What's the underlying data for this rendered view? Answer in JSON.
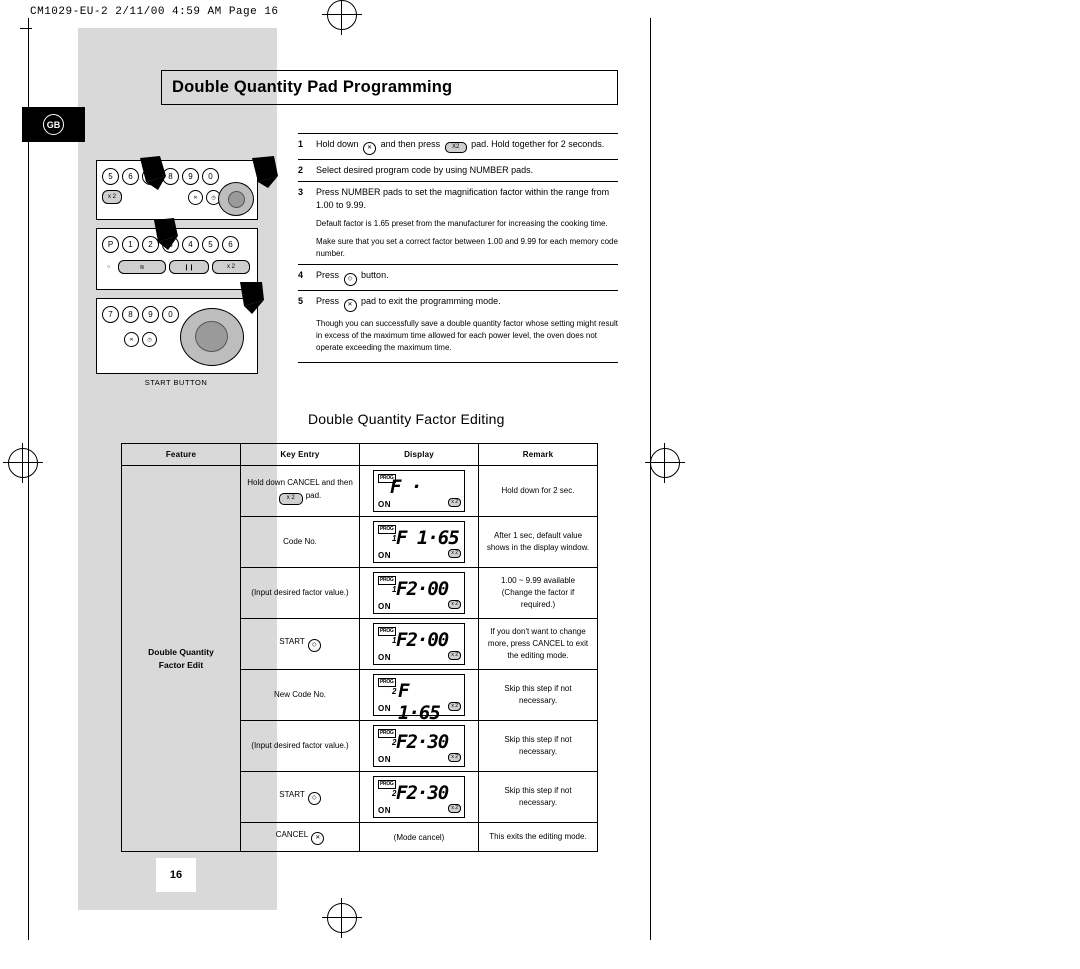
{
  "print_header": "CM1029-EU-2  2/11/00 4:59 AM  Page 16",
  "region_badge": "GB",
  "title": "Double Quantity Pad Programming",
  "steps": [
    {
      "num": "1",
      "text_parts": [
        "Hold down",
        "KEY1",
        "and then press",
        "X2",
        "pad. Hold together for 2 seconds."
      ]
    },
    {
      "num": "2",
      "text": "Select desired program code by using NUMBER pads."
    },
    {
      "num": "3",
      "text": "Press NUMBER pads to set the magnification factor within the range from 1.00 to 9.99.",
      "sub": [
        "Default factor is 1.65 preset from the manufacturer for increasing the cooking time.",
        "Make sure that you set a correct factor between 1.00 and 9.99 for each memory code number."
      ]
    },
    {
      "num": "4",
      "text_parts": [
        "Press",
        "KEY2",
        "button."
      ]
    },
    {
      "num": "5",
      "text_parts": [
        "Press",
        "KEY1",
        "pad to exit the programming mode."
      ],
      "sub": [
        "Though you can successfully save a double quantity factor whose setting might result in excess of the maximum time allowed for each power level, the oven does not operate exceeding the maximum time."
      ]
    }
  ],
  "panel": {
    "row1_keys": [
      "5",
      "6",
      "7",
      "8",
      "9",
      "0"
    ],
    "row1_pills": [
      "x 2"
    ],
    "row2_keys": [
      "P",
      "1",
      "2",
      "3",
      "4",
      "5",
      "6"
    ],
    "row2_pills": [
      "x 2"
    ],
    "row3_keys": [
      "7",
      "8",
      "9",
      "0"
    ],
    "start_label": "START BUTTON"
  },
  "section_heading": "Double Quantity Factor Editing",
  "table": {
    "headers": [
      "Feature",
      "Key Entry",
      "Display",
      "Remark"
    ],
    "feature_label_line1": "Double Quantity",
    "feature_label_line2": "Factor Edit",
    "rows": [
      {
        "key": "Hold down CANCEL and then",
        "key2": "pad.",
        "key_pill": "x 2",
        "display": {
          "prog": "PROG",
          "value": "F  ·",
          "on": "ON",
          "x2": "x 2",
          "italic_pre": ""
        },
        "remark": "Hold down for 2 sec."
      },
      {
        "key": "Code No.",
        "key2": "",
        "key_pill": "",
        "display": {
          "prog": "PROG",
          "value": "F 1·65",
          "on": "ON",
          "x2": "x 2",
          "italic_pre": "1"
        },
        "remark": "After 1 sec, default value shows in the display window."
      },
      {
        "key": "(Input desired factor value.)",
        "key2": "",
        "key_pill": "",
        "display": {
          "prog": "PROG",
          "value": "F2·00",
          "on": "ON",
          "x2": "x 2",
          "italic_pre": "1"
        },
        "remark": "1.00 ~ 9.99 available (Change the factor if required.)"
      },
      {
        "key": "START",
        "key2": "",
        "key_pill": "",
        "key_icon": "start-key-icon",
        "display": {
          "prog": "PROG",
          "value": "F2·00",
          "on": "ON",
          "x2": "x 2",
          "italic_pre": "1"
        },
        "remark": "If you don't want to change more, press CANCEL to exit the editing mode."
      },
      {
        "key": "New Code No.",
        "key2": "",
        "key_pill": "",
        "display": {
          "prog": "PROG",
          "value": "F 1·65",
          "on": "ON",
          "x2": "x 2",
          "italic_pre": "2"
        },
        "remark": "Skip this step if not necessary."
      },
      {
        "key": "(Input desired factor value.)",
        "key2": "",
        "key_pill": "",
        "display": {
          "prog": "PROG",
          "value": "F2·30",
          "on": "ON",
          "x2": "x 2",
          "italic_pre": "2"
        },
        "remark": "Skip this step if not necessary."
      },
      {
        "key": "START",
        "key2": "",
        "key_pill": "",
        "key_icon": "start-key-icon",
        "display": {
          "prog": "PROG",
          "value": "F2·30",
          "on": "ON",
          "x2": "x 2",
          "italic_pre": "2"
        },
        "remark": "Skip this step if not necessary."
      },
      {
        "key": "CANCEL",
        "key2": "",
        "key_pill": "",
        "key_icon": "cancel-key-icon",
        "display_text": "(Mode cancel)",
        "remark": "This exits the editing mode."
      }
    ]
  },
  "page_number": "16"
}
